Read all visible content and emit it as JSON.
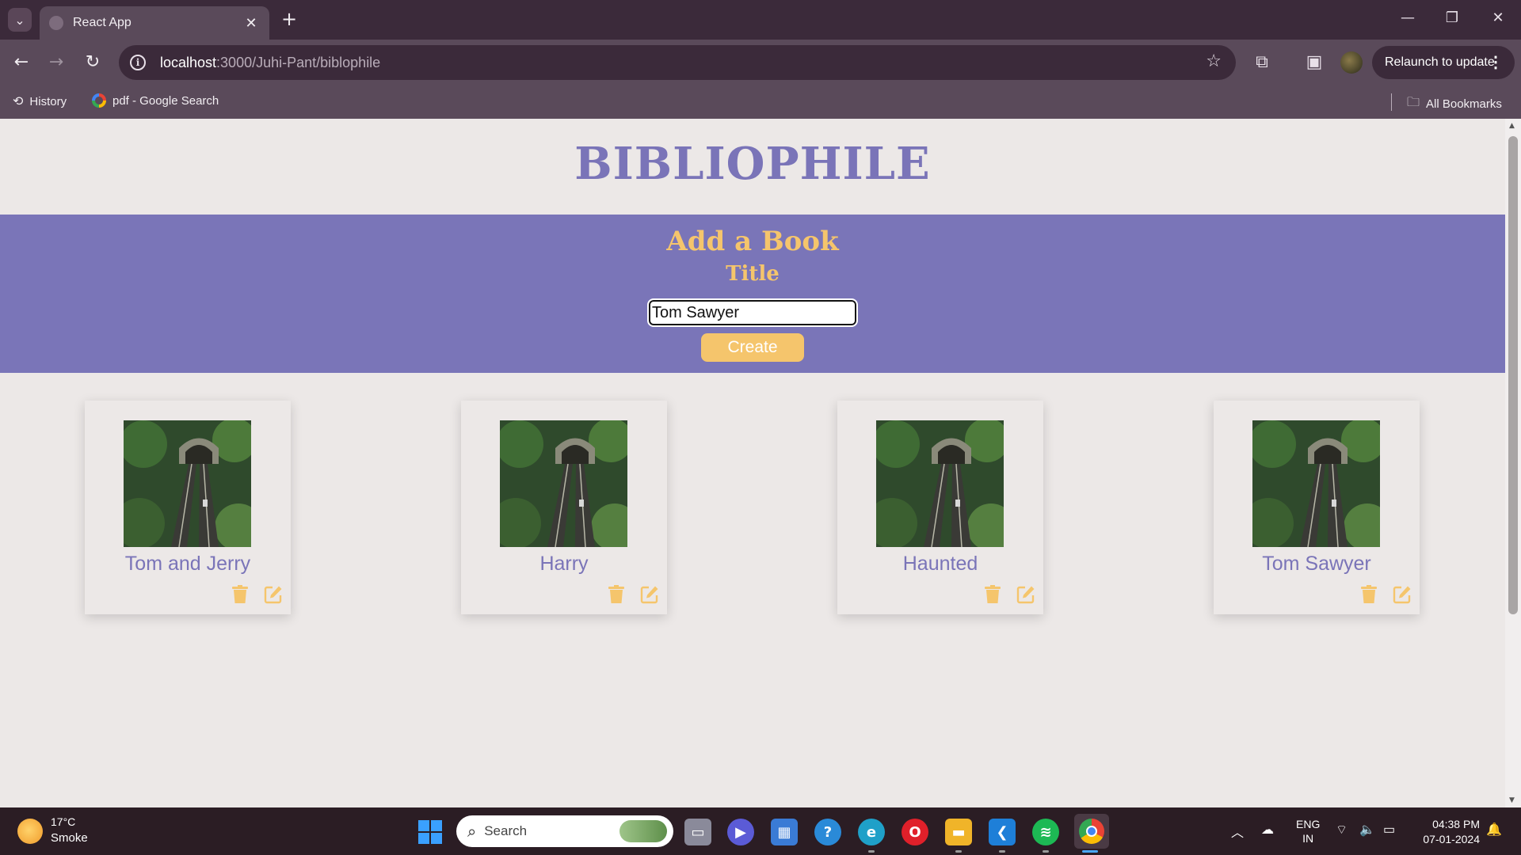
{
  "browser": {
    "tab_title": "React App",
    "url_host": "localhost",
    "url_path": ":3000/Juhi-Pant/biblophile",
    "relaunch_label": "Relaunch to update",
    "bookmarks": [
      {
        "label": "History",
        "icon": "history-icon"
      },
      {
        "label": "pdf - Google Search",
        "icon": "google-icon"
      }
    ],
    "all_bookmarks_label": "All Bookmarks"
  },
  "page": {
    "brand": "BIBLIOPHILE",
    "form": {
      "heading": "Add a Book",
      "field_label": "Title",
      "title_value": "Tom Sawyer",
      "create_label": "Create"
    },
    "books": [
      {
        "title": "Tom and Jerry",
        "delete_icon": "trash-icon",
        "edit_icon": "edit-icon"
      },
      {
        "title": "Harry",
        "delete_icon": "trash-icon",
        "edit_icon": "edit-icon"
      },
      {
        "title": "Haunted",
        "delete_icon": "trash-icon",
        "edit_icon": "edit-icon"
      },
      {
        "title": "Tom Sawyer",
        "delete_icon": "trash-icon",
        "edit_icon": "edit-icon"
      }
    ],
    "colors": {
      "accent": "#7a74b8",
      "highlight": "#f5c56c",
      "background": "#ece8e7"
    }
  },
  "taskbar": {
    "weather_temp": "17°C",
    "weather_desc": "Smoke",
    "search_label": "Search",
    "lang_line1": "ENG",
    "lang_line2": "IN",
    "time": "04:38 PM",
    "date": "07-01-2024"
  }
}
